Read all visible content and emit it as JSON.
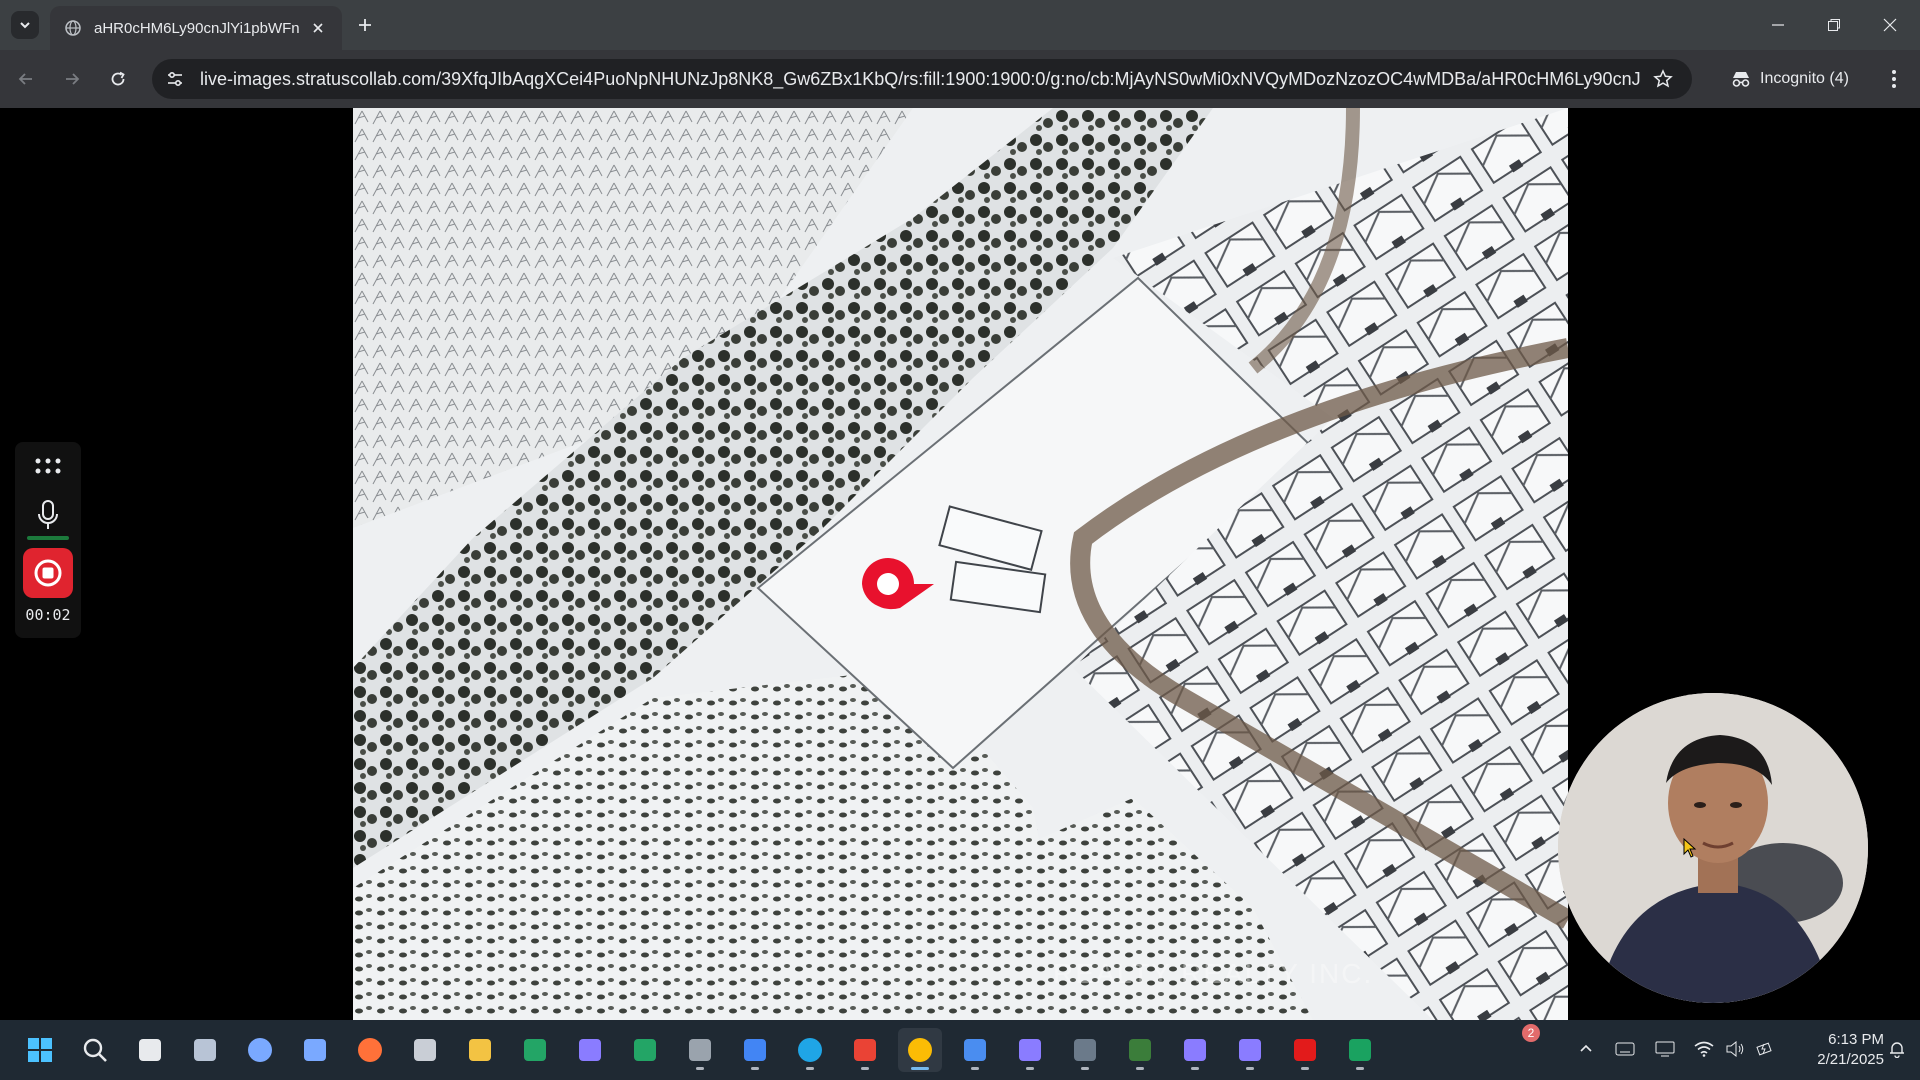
{
  "browser": {
    "tab": {
      "title": "aHR0cHM6Ly90cnJlYi1pbWFnZ",
      "favicon": "globe-icon"
    },
    "omnibox": {
      "url": "live-images.stratuscollab.com/39XfqJIbAqgXCei4PuoNpNHUNzJp8NK8_Gw6ZBx1KbQ/rs:fill:1900:1900:0/g:no/cb:MjAyNS0wMi0xNVQyMDozNzozOC4wMDBa/aHR0cHM6Ly90cnJlYi1pbWF..."
    },
    "incognito": {
      "label": "Incognito (4)"
    }
  },
  "page": {
    "watermark": "REALTY REALTY INC."
  },
  "recorder": {
    "timer": "00:02",
    "mic_level": 1.0
  },
  "taskbar": {
    "apps": [
      "windows-start-icon",
      "search-icon",
      "task-view-icon",
      "snipping-icon",
      "copilot-icon",
      "notes-icon",
      "firefox-icon",
      "calculator-icon",
      "file-explorer-icon",
      "sheets-icon",
      "app-icon",
      "sheets-icon",
      "media-icon",
      "docs-icon",
      "edge-icon",
      "gmail-icon",
      "chrome-icon",
      "calendar-icon",
      "app-icon",
      "toolbar-icon",
      "outlook-icon",
      "app-icon",
      "app-icon",
      "acrobat-icon",
      "kaspersky-icon"
    ],
    "weather_badge": "2",
    "clock": {
      "time": "6:13 PM",
      "date": "2/21/2025"
    }
  },
  "colors": {
    "tabstrip": "#3c4043",
    "toolbar": "#35363a",
    "omnibox": "#202124",
    "record": "#e0242f",
    "pin": "#e8112d",
    "taskbar": "#1f2933"
  }
}
